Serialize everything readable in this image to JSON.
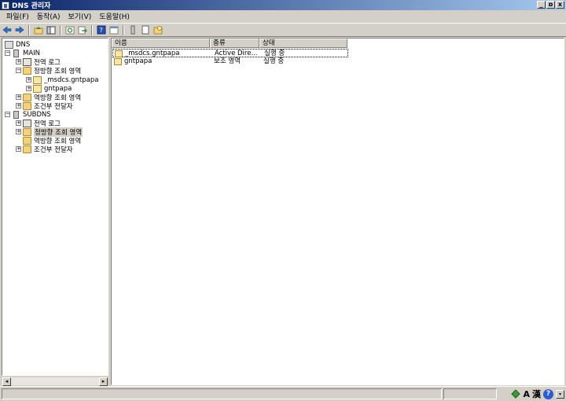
{
  "window": {
    "title": "DNS 관리자",
    "minimize": "_",
    "restore": "ɒ",
    "close": "x"
  },
  "menu": [
    "파일(F)",
    "동작(A)",
    "보기(V)",
    "도움말(H)"
  ],
  "tree": {
    "root": "DNS",
    "main": {
      "label": "MAIN",
      "global_log": "전역 로그",
      "forward_zones": "정방향 조회 영역",
      "zone_msdcs": "_msdcs.gntpapa",
      "zone_gntpapa": "gntpapa",
      "reverse_zones": "역방향 조회 영역",
      "conditional_forwarders": "조건부 전달자"
    },
    "sub": {
      "label": "SUBDNS",
      "global_log": "전역 로그",
      "forward_zones": "정방향 조회 영역",
      "reverse_zones": "역방향 조회 영역",
      "conditional_forwarders": "조건부 전달자"
    }
  },
  "list": {
    "columns": [
      "이름",
      "종류",
      "상태"
    ],
    "rows": [
      {
        "name": "_msdcs.gntpapa",
        "type": "Active Dire...",
        "status": "실행 중"
      },
      {
        "name": "gntpapa",
        "type": "보조 영역",
        "status": "실행 중"
      }
    ]
  },
  "scroll": {
    "left": "◂",
    "right": "▸"
  },
  "tray": {
    "lang": "A",
    "hanja": "漢",
    "help": "?",
    "down": "▾"
  },
  "colors": {
    "title_start": "#0a246a",
    "title_end": "#a6caf0",
    "face": "#d4d0c8"
  }
}
